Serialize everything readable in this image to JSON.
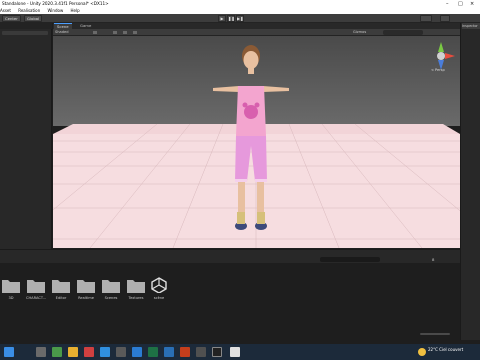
{
  "window": {
    "title": "Standalone - Unity 2020.3.41f1 Personal* <DX11>",
    "controls": [
      "–",
      "□",
      "×"
    ]
  },
  "menu": {
    "items": [
      "Asset",
      "Realisation",
      "Window",
      "Help"
    ]
  },
  "toolbar": {
    "left_buttons": [
      "Center",
      "Global"
    ],
    "play_icons": [
      "▶",
      "❚❚",
      "▶❚"
    ]
  },
  "scene_tabs": {
    "tabs": [
      "Scene",
      "Game"
    ],
    "active": "Scene",
    "shading_mode": "Shaded",
    "gizmos_label": "Gizmos",
    "search_placeholder": "All"
  },
  "gizmo": {
    "view_label": "< Persp"
  },
  "right_panel": {
    "title": "Inspector"
  },
  "project": {
    "folders": [
      {
        "name": "3D",
        "kind": "folder"
      },
      {
        "name": "CHARACT...",
        "kind": "folder"
      },
      {
        "name": "Editor",
        "kind": "folder"
      },
      {
        "name": "Realtime",
        "kind": "folder"
      },
      {
        "name": "Scenes",
        "kind": "folder"
      },
      {
        "name": "Textures",
        "kind": "folder"
      },
      {
        "name": "scène",
        "kind": "unity"
      }
    ],
    "counter": "8"
  },
  "taskbar": {
    "temperature": "22°C",
    "weather": "Ciel couvert"
  },
  "colors": {
    "ground": "#f6dde0",
    "sky": "#5a5a5a",
    "shirt": "#f3a5cf",
    "pants": "#e699dc",
    "skin": "#e8c0a0",
    "hair": "#8a5a35"
  }
}
